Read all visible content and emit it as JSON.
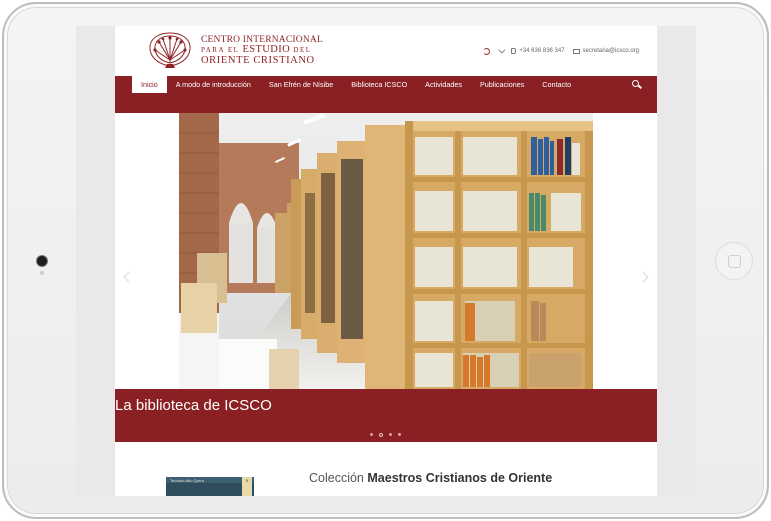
{
  "logo": {
    "line1": "CENTRO INTERNACIONAL",
    "line2_pre": "PARA EL",
    "line2_big": "ESTUDIO",
    "line2_post": "DEL",
    "line3": "ORIENTE CRISTIANO"
  },
  "contact": {
    "phone": "+34 636 836 347",
    "email": "secretaria@icsco.org"
  },
  "nav": {
    "items": [
      "Inicio",
      "A modo de introducción",
      "San Efrén de Nísibe",
      "Biblioteca ICSCO",
      "Actividades",
      "Publicaciones",
      "Contacto"
    ]
  },
  "slider": {
    "caption": "La biblioteca de ICSCO",
    "slide_count": 4,
    "active_index": 1
  },
  "collection": {
    "title_prefix": "Colección",
    "title_bold": "Maestros Cristianos de Oriente",
    "book_title": "Teodoro Abu Qurra",
    "book_number": "5"
  },
  "colors": {
    "brand": "#8a2023",
    "frame": "#ececec"
  }
}
